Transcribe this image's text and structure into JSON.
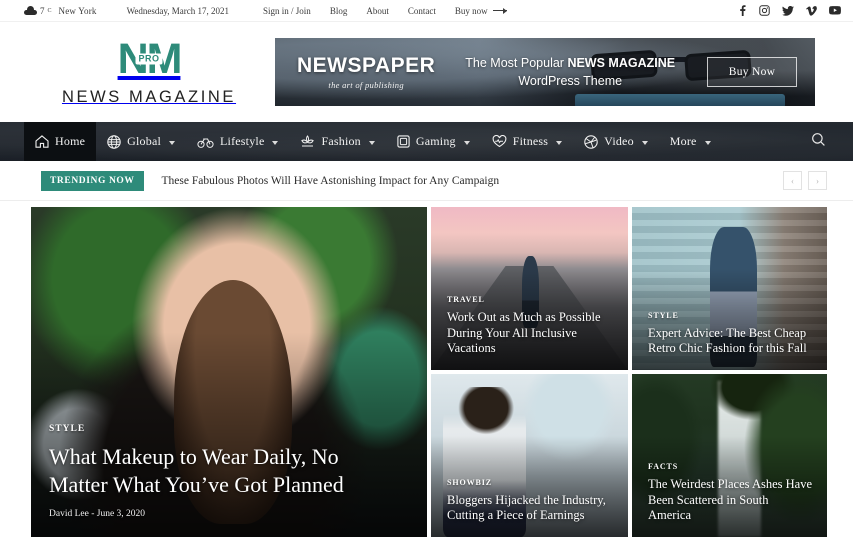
{
  "topbar": {
    "temperature": "7",
    "degree_unit": "C",
    "city": "New York",
    "date": "Wednesday, March 17, 2021",
    "links": [
      "Sign in / Join",
      "Blog",
      "About",
      "Contact"
    ],
    "buy_now": "Buy now",
    "social": [
      "facebook-icon",
      "instagram-icon",
      "twitter-icon",
      "vimeo-icon",
      "youtube-icon"
    ]
  },
  "header": {
    "logo_mark": "NM",
    "logo_badge": "PRO",
    "logo_text": "NEWS MAGAZINE",
    "banner": {
      "title": "NEWSPAPER",
      "subtitle": "the art of publishing",
      "tagline_line1_pre": "The Most Popular ",
      "tagline_line1_bold": "NEWS MAGAZINE",
      "tagline_line2": "WordPress Theme",
      "cta": "Buy Now"
    }
  },
  "nav": {
    "items": [
      {
        "label": "Home",
        "icon": "home-icon",
        "has_caret": false,
        "active": true
      },
      {
        "label": "Global",
        "icon": "globe-icon",
        "has_caret": true,
        "active": false
      },
      {
        "label": "Lifestyle",
        "icon": "bicycle-icon",
        "has_caret": true,
        "active": false
      },
      {
        "label": "Fashion",
        "icon": "dress-icon",
        "has_caret": true,
        "active": false
      },
      {
        "label": "Gaming",
        "icon": "gamepad-icon",
        "has_caret": true,
        "active": false
      },
      {
        "label": "Fitness",
        "icon": "heart-icon",
        "has_caret": true,
        "active": false
      },
      {
        "label": "Video",
        "icon": "aperture-icon",
        "has_caret": true,
        "active": false
      },
      {
        "label": "More",
        "icon": "",
        "has_caret": true,
        "active": false
      }
    ],
    "search_icon": "search-icon"
  },
  "trending": {
    "badge": "TRENDING NOW",
    "headline": "These Fabulous Photos Will Have Astonishing Impact for Any Campaign",
    "prev": "‹",
    "next": "›"
  },
  "cards": {
    "hero": {
      "category": "STYLE",
      "title": "What Makeup to Wear Daily, No Matter What You’ve Got Planned",
      "author": "David Lee",
      "separator": "-",
      "date": "June 3, 2020"
    },
    "travel": {
      "category": "TRAVEL",
      "title": "Work Out as Much as Possible During Your All Inclusive Vacations"
    },
    "style": {
      "category": "STYLE",
      "title": "Expert Advice: The Best Cheap Retro Chic Fashion for this Fall"
    },
    "showbiz": {
      "category": "SHOWBIZ",
      "title": "Bloggers Hijacked the Industry, Cutting a Piece of Earnings"
    },
    "facts": {
      "category": "FACTS",
      "title": "The Weirdest Places Ashes Have Been Scattered in South America"
    }
  },
  "colors": {
    "brand_teal": "#2e8b7a",
    "nav_dark": "#1c2127",
    "nav_active": "#0c0f12"
  }
}
